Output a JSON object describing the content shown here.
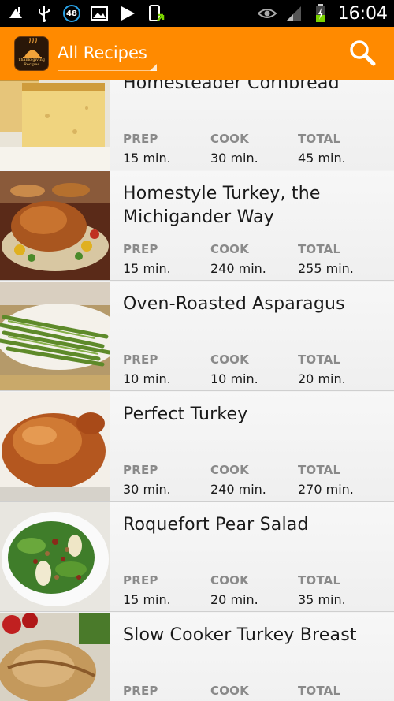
{
  "status_bar": {
    "notification_badge": "48",
    "time": "16:04",
    "icons": [
      "usb-debug-icon",
      "usb-icon",
      "notification-count-badge",
      "gallery-icon",
      "play-store-icon",
      "app-update-icon",
      "eye-icon",
      "signal-icon",
      "battery-charging-icon"
    ]
  },
  "action_bar": {
    "title": "All Recipes",
    "logo_text": "Thanksgiving Recipes",
    "color": "#ff8a00"
  },
  "labels": {
    "prep": "PREP",
    "cook": "COOK",
    "total": "TOTAL"
  },
  "recipes": [
    {
      "title": "Homesteader Cornbread",
      "prep": "15 min.",
      "cook": "30 min.",
      "total": "45 min.",
      "image": "cornbread"
    },
    {
      "title": "Homestyle Turkey, the Michigander Way",
      "prep": "15 min.",
      "cook": "240 min.",
      "total": "255 min.",
      "image": "turkey-platter"
    },
    {
      "title": "Oven-Roasted Asparagus",
      "prep": "10 min.",
      "cook": "10 min.",
      "total": "20 min.",
      "image": "asparagus"
    },
    {
      "title": "Perfect Turkey",
      "prep": "30 min.",
      "cook": "240 min.",
      "total": "270 min.",
      "image": "roast-turkey"
    },
    {
      "title": "Roquefort Pear Salad",
      "prep": "15 min.",
      "cook": "20 min.",
      "total": "35 min.",
      "image": "pear-salad"
    },
    {
      "title": "Slow Cooker Turkey Breast",
      "prep": "",
      "cook": "",
      "total": "",
      "image": "turkey-breast"
    }
  ]
}
